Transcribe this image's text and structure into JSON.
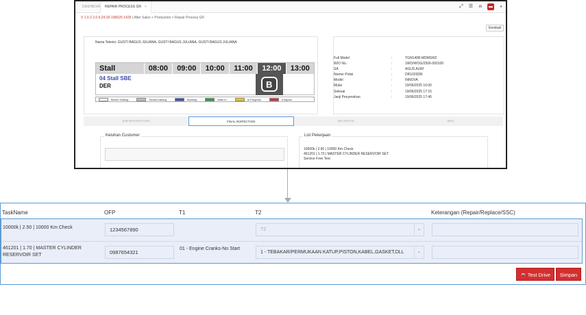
{
  "tabs": [
    {
      "label": "DASHBOARD",
      "active": false
    },
    {
      "label": "REPAIR PROCESS GR",
      "active": true
    }
  ],
  "breadcrumb": {
    "version": "V 1.0.2 2.0.5.24.20-190625-1426",
    "path": " | After Sales > Production > Repair Process GR"
  },
  "buttons": {
    "kembali": "Kembali",
    "test_drive": "Test Drive",
    "simpan": "Simpan"
  },
  "teknisi_label": "Nama Teknisi: GUSTI BAGUS JULIANA, GUSTI BAGUS JULIANA, GUSTI BAGUS JULIANA",
  "schedule": {
    "stall_header": "Stall",
    "times": [
      "08:00",
      "09:00",
      "10:00",
      "11:00",
      "12:00",
      "13:00"
    ],
    "stall_name": "04 Stall SBE",
    "stall_sub": "DER",
    "block_glyph": "B"
  },
  "legend": [
    {
      "label": "Belum Datang",
      "color": "#ffffff"
    },
    {
      "label": "Sudah Datang",
      "color": "#bdbdbd"
    },
    {
      "label": "Booking",
      "color": "#3f51b5"
    },
    {
      "label": "Walk In",
      "color": "#2e9e3a"
    },
    {
      "label": "In Progress",
      "color": "#f5c400"
    },
    {
      "label": "Irregular",
      "color": "#d32f2f"
    }
  ],
  "vehicle_info": [
    {
      "label": "Full Model",
      "value": "TGN140R-MDMSKD"
    },
    {
      "label": "W/O No.",
      "value": "1WO/WOG/2506-000100"
    },
    {
      "label": "SA",
      "value": "AGUS ALWI"
    },
    {
      "label": "Nomor Polisi",
      "value": "DR1020DR"
    },
    {
      "label": "Model",
      "value": "INNOVA"
    },
    {
      "label": "Mulai",
      "value": "19/06/2025 16:00"
    },
    {
      "label": "Selesai",
      "value": "19/06/2025 17:15"
    },
    {
      "label": "Janji Penyerahan",
      "value": "19/06/2025 17:45"
    }
  ],
  "sub_tabs": [
    {
      "label": "JOB INSTRUCTION",
      "active": false
    },
    {
      "label": "FINAL INSPECTION",
      "active": true
    },
    {
      "label": "WO DETAIL",
      "active": false
    },
    {
      "label": "WAC",
      "active": false
    }
  ],
  "keluhan": {
    "caption": "Keluhan Customer"
  },
  "pekerjaan": {
    "caption": "List Pekerjaan",
    "items": [
      "10000k | 2.50 | 10000 Km Check",
      "461201 | 1.70 | MASTER CYLINDER RESERVOIR SET",
      "Service Free Text"
    ]
  },
  "table": {
    "headers": [
      "TaskName",
      "OFP",
      "T1",
      "T2",
      "Keterangan (Repair/Replace/SSC)"
    ],
    "rows": [
      {
        "task": "10000k | 2.50 | 10000 Km Check",
        "ofp": "1234567890",
        "t1": "",
        "t2": "T2",
        "t2_placeholder": true,
        "keterangan": ""
      },
      {
        "task": "461201 | 1.70 | MASTER CYLINDER RESERVOIR SET",
        "ofp": "0987654321",
        "t1": "01 - Engine Cranks-No Start",
        "t2": "1 - TEBAKAR/PERMUKAAN KATUP,PISTON,KABEL,GASKET,DLL",
        "t2_placeholder": false,
        "keterangan": ""
      }
    ]
  }
}
